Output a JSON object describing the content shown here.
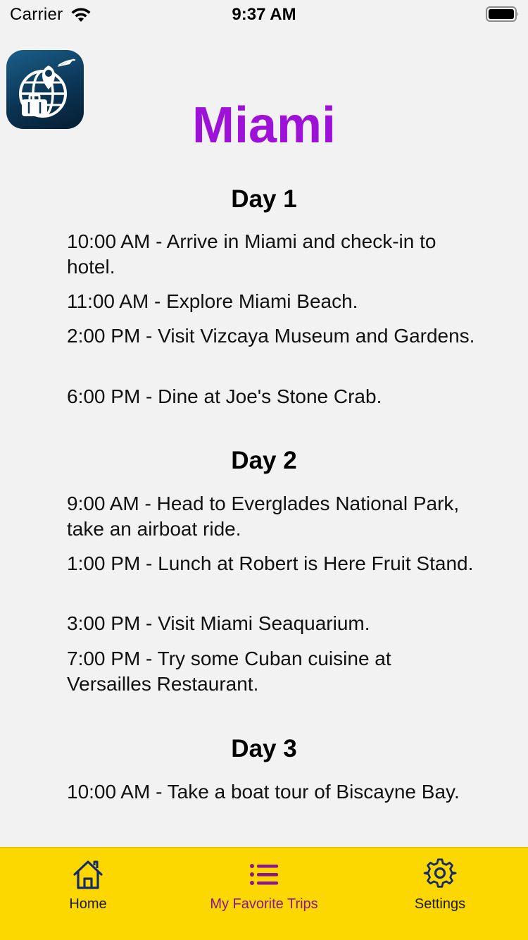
{
  "status_bar": {
    "carrier": "Carrier",
    "time": "9:37 AM",
    "wifi_icon": "wifi-icon",
    "battery_icon": "battery-icon"
  },
  "app_icon": "globe-location-suitcase-icon",
  "title": "Miami",
  "colors": {
    "title": "#9d12d6",
    "tab_bar": "#fcd800",
    "tab_active": "#8a1590",
    "tab_inactive": "#1a1a1a",
    "background": "#f2f2f2"
  },
  "days": [
    {
      "heading": "Day 1",
      "activities": [
        "10:00 AM - Arrive in Miami and check-in to hotel.",
        "11:00 AM - Explore Miami Beach.",
        "2:00 PM - Visit Vizcaya Museum and Gardens.",
        "6:00 PM - Dine at Joe's Stone Crab."
      ]
    },
    {
      "heading": "Day 2",
      "activities": [
        "9:00 AM - Head to Everglades National Park, take an airboat ride.",
        "1:00 PM - Lunch at Robert is Here Fruit Stand.",
        "3:00 PM - Visit Miami Seaquarium.",
        "7:00 PM - Try some Cuban cuisine at Versailles Restaurant."
      ]
    },
    {
      "heading": "Day 3",
      "activities": [
        "10:00 AM - Take a boat tour of Biscayne Bay."
      ]
    }
  ],
  "tab_bar": {
    "tabs": [
      {
        "label": "Home",
        "icon": "house-icon",
        "active": false
      },
      {
        "label": "My Favorite Trips",
        "icon": "list-icon",
        "active": true
      },
      {
        "label": "Settings",
        "icon": "gear-icon",
        "active": false
      }
    ]
  }
}
